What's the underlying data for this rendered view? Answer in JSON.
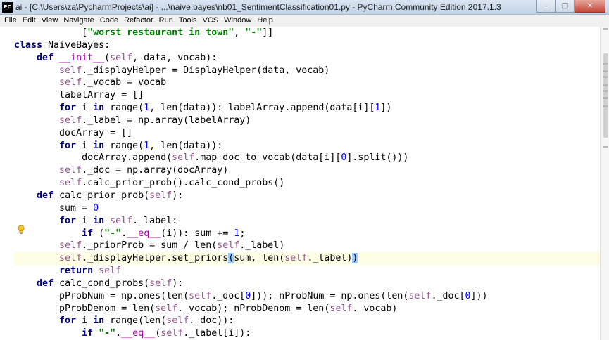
{
  "titlebar": {
    "app_icon_text": "PC",
    "title": "ai - [C:\\Users\\za\\PycharmProjects\\ai] - ...\\naive bayes\\nb01_SentimentClassification01.py - PyCharm Community Edition 2017.1.3",
    "minimize_glyph": "–",
    "maximize_glyph": "□",
    "close_glyph": "✕"
  },
  "menu": [
    "File",
    "Edit",
    "View",
    "Navigate",
    "Code",
    "Refactor",
    "Run",
    "Tools",
    "VCS",
    "Window",
    "Help"
  ],
  "editor": {
    "current_line_index": 18,
    "lines": [
      [
        {
          "t": "            [",
          "c": ""
        },
        {
          "t": "\"worst restaurant in town\"",
          "c": "str"
        },
        {
          "t": ", ",
          "c": ""
        },
        {
          "t": "\"-\"",
          "c": "str"
        },
        {
          "t": "]]",
          "c": ""
        }
      ],
      [
        {
          "t": "class ",
          "c": "kw"
        },
        {
          "t": "NaiveBayes:",
          "c": ""
        }
      ],
      [
        {
          "t": "    ",
          "c": ""
        },
        {
          "t": "def ",
          "c": "kw"
        },
        {
          "t": "__init__",
          "c": "magic"
        },
        {
          "t": "(",
          "c": ""
        },
        {
          "t": "self",
          "c": "self"
        },
        {
          "t": ", data, vocab):",
          "c": ""
        }
      ],
      [
        {
          "t": "        ",
          "c": ""
        },
        {
          "t": "self",
          "c": "self"
        },
        {
          "t": "._displayHelper = DisplayHelper(data, vocab)",
          "c": ""
        }
      ],
      [
        {
          "t": "        ",
          "c": ""
        },
        {
          "t": "self",
          "c": "self"
        },
        {
          "t": "._vocab = vocab",
          "c": ""
        }
      ],
      [
        {
          "t": "        labelArray = []",
          "c": ""
        }
      ],
      [
        {
          "t": "        ",
          "c": ""
        },
        {
          "t": "for ",
          "c": "kw"
        },
        {
          "t": "i ",
          "c": ""
        },
        {
          "t": "in ",
          "c": "kw"
        },
        {
          "t": "range(",
          "c": ""
        },
        {
          "t": "1",
          "c": "num"
        },
        {
          "t": ", len(data)): labelArray.append(data[i][",
          "c": ""
        },
        {
          "t": "1",
          "c": "num"
        },
        {
          "t": "])",
          "c": ""
        }
      ],
      [
        {
          "t": "        ",
          "c": ""
        },
        {
          "t": "self",
          "c": "self"
        },
        {
          "t": "._label = np.array(labelArray)",
          "c": ""
        }
      ],
      [
        {
          "t": "        docArray = []",
          "c": ""
        }
      ],
      [
        {
          "t": "        ",
          "c": ""
        },
        {
          "t": "for ",
          "c": "kw"
        },
        {
          "t": "i ",
          "c": ""
        },
        {
          "t": "in ",
          "c": "kw"
        },
        {
          "t": "range(",
          "c": ""
        },
        {
          "t": "1",
          "c": "num"
        },
        {
          "t": ", len(data)):",
          "c": ""
        }
      ],
      [
        {
          "t": "            docArray.append(",
          "c": ""
        },
        {
          "t": "self",
          "c": "self"
        },
        {
          "t": ".map_doc_to_vocab(data[i][",
          "c": ""
        },
        {
          "t": "0",
          "c": "num"
        },
        {
          "t": "].split()))",
          "c": ""
        }
      ],
      [
        {
          "t": "        ",
          "c": ""
        },
        {
          "t": "self",
          "c": "self"
        },
        {
          "t": "._doc = np.array(docArray)",
          "c": ""
        }
      ],
      [
        {
          "t": "        ",
          "c": ""
        },
        {
          "t": "self",
          "c": "self"
        },
        {
          "t": ".calc_prior_prob().calc_cond_probs()",
          "c": ""
        }
      ],
      [
        {
          "t": "    ",
          "c": ""
        },
        {
          "t": "def ",
          "c": "kw"
        },
        {
          "t": "calc_prior_prob(",
          "c": ""
        },
        {
          "t": "self",
          "c": "self"
        },
        {
          "t": "):",
          "c": ""
        }
      ],
      [
        {
          "t": "        sum = ",
          "c": ""
        },
        {
          "t": "0",
          "c": "num"
        }
      ],
      [
        {
          "t": "        ",
          "c": ""
        },
        {
          "t": "for ",
          "c": "kw"
        },
        {
          "t": "i ",
          "c": ""
        },
        {
          "t": "in ",
          "c": "kw"
        },
        {
          "t": "self",
          "c": "self"
        },
        {
          "t": "._label:",
          "c": ""
        }
      ],
      [
        {
          "t": "            ",
          "c": ""
        },
        {
          "t": "if ",
          "c": "kw"
        },
        {
          "t": "(",
          "c": ""
        },
        {
          "t": "\"-\"",
          "c": "str"
        },
        {
          "t": ".",
          "c": ""
        },
        {
          "t": "__eq__",
          "c": "magic"
        },
        {
          "t": "(i)): sum += ",
          "c": ""
        },
        {
          "t": "1",
          "c": "num"
        },
        {
          "t": ";",
          "c": ""
        }
      ],
      [
        {
          "t": "        ",
          "c": ""
        },
        {
          "t": "self",
          "c": "self"
        },
        {
          "t": "._priorProb = sum / len(",
          "c": ""
        },
        {
          "t": "self",
          "c": "self"
        },
        {
          "t": "._label)",
          "c": ""
        }
      ],
      [
        {
          "t": "        ",
          "c": ""
        },
        {
          "t": "self",
          "c": "self"
        },
        {
          "t": "._displayHelper.set_priors",
          "c": ""
        },
        {
          "t": "(",
          "c": "bracket-hl"
        },
        {
          "t": "sum, len(",
          "c": ""
        },
        {
          "t": "self",
          "c": "self"
        },
        {
          "t": "._label)",
          "c": ""
        },
        {
          "t": ")",
          "c": "bracket-hl"
        }
      ],
      [
        {
          "t": "        ",
          "c": ""
        },
        {
          "t": "return ",
          "c": "kw"
        },
        {
          "t": "self",
          "c": "self"
        }
      ],
      [
        {
          "t": "    ",
          "c": ""
        },
        {
          "t": "def ",
          "c": "kw"
        },
        {
          "t": "calc_cond_probs(",
          "c": ""
        },
        {
          "t": "self",
          "c": "self"
        },
        {
          "t": "):",
          "c": ""
        }
      ],
      [
        {
          "t": "        pProbNum = np.ones(len(",
          "c": ""
        },
        {
          "t": "self",
          "c": "self"
        },
        {
          "t": "._doc[",
          "c": ""
        },
        {
          "t": "0",
          "c": "num"
        },
        {
          "t": "])); nProbNum = np.ones(len(",
          "c": ""
        },
        {
          "t": "self",
          "c": "self"
        },
        {
          "t": "._doc[",
          "c": ""
        },
        {
          "t": "0",
          "c": "num"
        },
        {
          "t": "]))",
          "c": ""
        }
      ],
      [
        {
          "t": "        pProbDenom = len(",
          "c": ""
        },
        {
          "t": "self",
          "c": "self"
        },
        {
          "t": "._vocab); nProbDenom = len(",
          "c": ""
        },
        {
          "t": "self",
          "c": "self"
        },
        {
          "t": "._vocab)",
          "c": ""
        }
      ],
      [
        {
          "t": "        ",
          "c": ""
        },
        {
          "t": "for ",
          "c": "kw"
        },
        {
          "t": "i ",
          "c": ""
        },
        {
          "t": "in ",
          "c": "kw"
        },
        {
          "t": "range(len(",
          "c": ""
        },
        {
          "t": "self",
          "c": "self"
        },
        {
          "t": "._doc)):",
          "c": ""
        }
      ],
      [
        {
          "t": "            ",
          "c": ""
        },
        {
          "t": "if ",
          "c": "kw"
        },
        {
          "t": "\"-\"",
          "c": "str"
        },
        {
          "t": ".",
          "c": ""
        },
        {
          "t": "__eq__",
          "c": "magic"
        },
        {
          "t": "(",
          "c": ""
        },
        {
          "t": "self",
          "c": "self"
        },
        {
          "t": "._label[i]):",
          "c": ""
        }
      ]
    ]
  },
  "colors": {
    "keyword": "#000080",
    "self": "#94558d",
    "string": "#008000",
    "number": "#0000ff",
    "magic": "#b200b2",
    "current_line": "#fdfde4",
    "bracket_highlight": "#99ccff"
  },
  "icons": {
    "gutter": "lightbulb-icon"
  }
}
